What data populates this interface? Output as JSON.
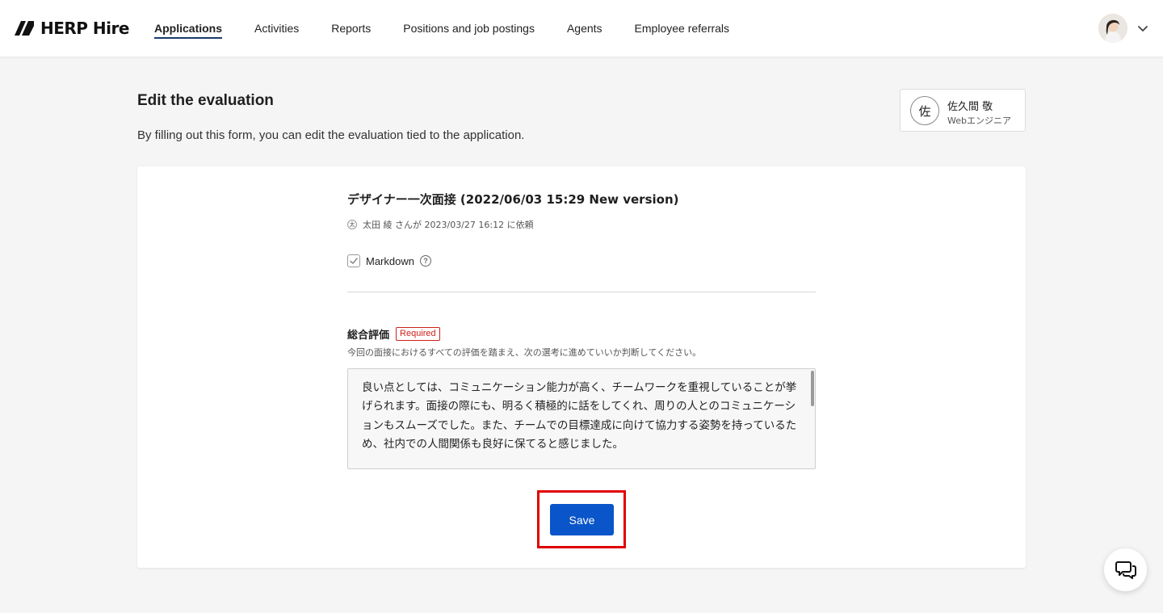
{
  "header": {
    "logo_text": "HERP Hire",
    "nav": [
      {
        "label": "Applications",
        "active": true
      },
      {
        "label": "Activities",
        "active": false
      },
      {
        "label": "Reports",
        "active": false
      },
      {
        "label": "Positions and job postings",
        "active": false
      },
      {
        "label": "Agents",
        "active": false
      },
      {
        "label": "Employee referrals",
        "active": false
      }
    ],
    "user_avatar_icon": "user-photo-avatar",
    "menu_icon": "chevron-down-icon"
  },
  "page": {
    "title": "Edit the evaluation",
    "description": "By filling out this form, you can edit the evaluation tied to the application."
  },
  "candidate": {
    "avatar_char": "佐",
    "name": "佐久間 敬",
    "role": "Webエンジニア"
  },
  "evaluation": {
    "title": "デザイナー一次面接 (2022/06/03 15:29 New version)",
    "requester_avatar": "太",
    "requested_text": "太田 綾 さんが 2023/03/27 16:12 に依頼",
    "markdown_label": "Markdown",
    "markdown_checked": true,
    "field": {
      "label": "総合評価",
      "required_badge": "Required",
      "help": "今回の面接におけるすべての評価を踏まえ、次の選考に進めていいか判断してください。",
      "value": "良い点としては、コミュニケーション能力が高く、チームワークを重視していることが挙げられます。面接の際にも、明るく積極的に話をしてくれ、周りの人とのコミュニケーションもスムーズでした。また、チームでの目標達成に向けて協力する姿勢を持っているため、社内での人間関係も良好に保てると感じました。\n\n一方、課題点としては、セールス経験が浅く、商品知識に不足があることが挙げられま"
    },
    "save_label": "Save"
  },
  "colors": {
    "primary": "#0a55c9",
    "required": "#d0201b",
    "highlight": "#e00000",
    "nav_underline": "#1a3a6b"
  },
  "chat_icon": "chat-bubbles-icon"
}
